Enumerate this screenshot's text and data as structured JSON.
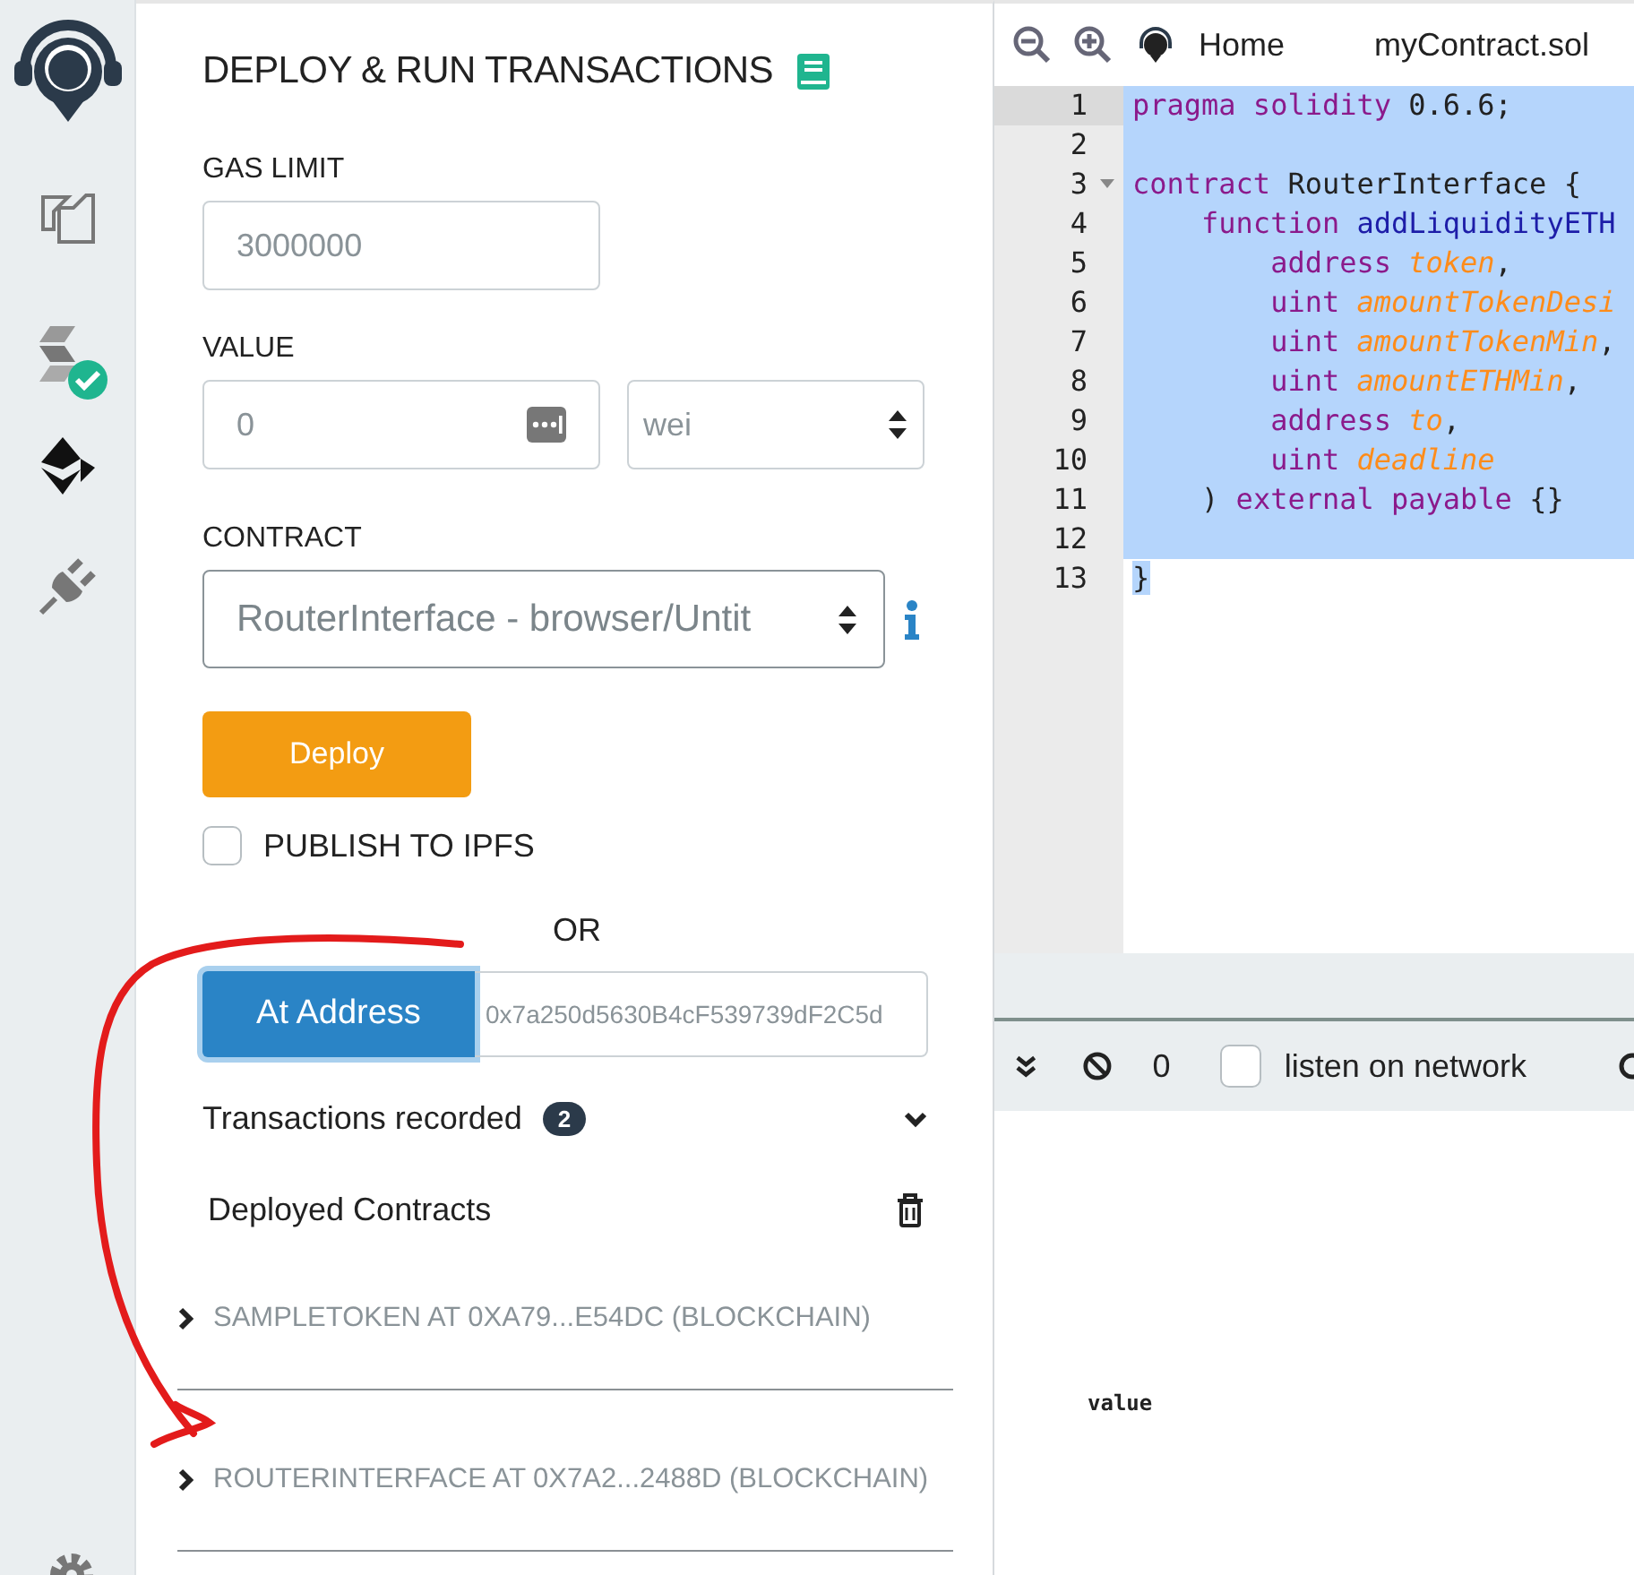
{
  "panel": {
    "title": "DEPLOY & RUN TRANSACTIONS",
    "gas_limit": {
      "label": "GAS LIMIT",
      "value": "3000000"
    },
    "value": {
      "label": "VALUE",
      "value": "0",
      "unit": "wei"
    },
    "contract": {
      "label": "CONTRACT",
      "value": "RouterInterface - browser/Untit"
    },
    "deploy_button": "Deploy",
    "publish": {
      "label": "PUBLISH TO IPFS",
      "checked": false
    },
    "or": "OR",
    "at_address": {
      "button": "At Address",
      "value": "0x7a250d5630B4cF539739dF2C5d"
    },
    "transactions": {
      "label": "Transactions recorded",
      "count": "2"
    },
    "deployed": {
      "label": "Deployed Contracts",
      "instances": [
        {
          "label": "SAMPLETOKEN AT 0XA79...E54DC (BLOCKCHAIN)",
          "expanded": false
        },
        {
          "label": "ROUTERINTERFACE AT 0X7A2...2488D (BLOCKCHAIN)",
          "expanded": false
        }
      ]
    }
  },
  "editor": {
    "tabs": [
      {
        "label": "Home",
        "kind": "home"
      },
      {
        "label": "myContract.sol",
        "kind": "file"
      }
    ],
    "lines": [
      {
        "number": "1",
        "active": true,
        "foldable": false,
        "selected": true,
        "tokens": [
          {
            "text": "pragma solidity",
            "kind": "keyword"
          },
          {
            "text": " 0.6.6;",
            "kind": "plain"
          }
        ]
      },
      {
        "number": "2",
        "active": false,
        "foldable": false,
        "selected": true
      },
      {
        "number": "3",
        "active": false,
        "foldable": true,
        "selected": true,
        "tokens": [
          {
            "text": "contract",
            "kind": "keyword"
          },
          {
            "text": " RouterInterface {",
            "kind": "plain"
          }
        ]
      },
      {
        "number": "4",
        "active": false,
        "foldable": false,
        "selected": true,
        "tokens": [
          {
            "text": "    function",
            "kind": "keyword"
          },
          {
            "text": " addLiquidityETH",
            "kind": "function"
          }
        ]
      },
      {
        "number": "5",
        "active": false,
        "foldable": false,
        "selected": true,
        "tokens": [
          {
            "text": "        address",
            "kind": "keyword"
          },
          {
            "text": " token",
            "kind": "param"
          },
          {
            "text": ",",
            "kind": "plain"
          }
        ]
      },
      {
        "number": "6",
        "active": false,
        "foldable": false,
        "selected": true,
        "tokens": [
          {
            "text": "        uint",
            "kind": "keyword"
          },
          {
            "text": " amountTokenDesi",
            "kind": "param"
          }
        ]
      },
      {
        "number": "7",
        "active": false,
        "foldable": false,
        "selected": true,
        "tokens": [
          {
            "text": "        uint",
            "kind": "keyword"
          },
          {
            "text": " amountTokenMin",
            "kind": "param"
          },
          {
            "text": ",",
            "kind": "plain"
          }
        ]
      },
      {
        "number": "8",
        "active": false,
        "foldable": false,
        "selected": true,
        "tokens": [
          {
            "text": "        uint",
            "kind": "keyword"
          },
          {
            "text": " amountETHMin",
            "kind": "param"
          },
          {
            "text": ",",
            "kind": "plain"
          }
        ]
      },
      {
        "number": "9",
        "active": false,
        "foldable": false,
        "selected": true,
        "tokens": [
          {
            "text": "        address",
            "kind": "keyword"
          },
          {
            "text": " to",
            "kind": "param"
          },
          {
            "text": ",",
            "kind": "plain"
          }
        ]
      },
      {
        "number": "10",
        "active": false,
        "foldable": false,
        "selected": true,
        "tokens": [
          {
            "text": "        uint",
            "kind": "keyword"
          },
          {
            "text": " deadline",
            "kind": "param"
          }
        ]
      },
      {
        "number": "11",
        "active": false,
        "foldable": false,
        "selected": true,
        "tokens": [
          {
            "text": "    )",
            "kind": "plain"
          },
          {
            "text": " external payable",
            "kind": "keyword"
          },
          {
            "text": " {}",
            "kind": "plain"
          }
        ]
      },
      {
        "number": "12",
        "active": false,
        "foldable": false,
        "selected": true
      },
      {
        "number": "13",
        "active": false,
        "foldable": false,
        "selected": false,
        "tokens": [
          {
            "text": "}",
            "kind": "plain",
            "selected": true
          }
        ]
      }
    ]
  },
  "terminal": {
    "count": "0",
    "listen": {
      "label": "listen on network",
      "checked": false
    },
    "output": "value"
  }
}
